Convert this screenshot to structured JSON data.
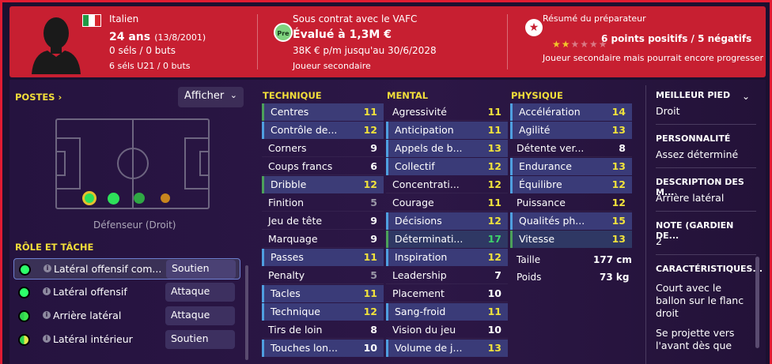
{
  "header": {
    "nationality": "Italien",
    "age_label": "24 ans",
    "birthdate": "(13/8/2001)",
    "caps": "0 séls / 0 buts",
    "u21_caps": "6 séls U21 / 0 buts",
    "contract_badge": "Pre",
    "contract_status": "Sous contrat avec le VAFC",
    "value": "Évalué à 1,3M €",
    "wage": "38K € p/m jusqu'au 30/6/2028",
    "squad_status": "Joueur secondaire",
    "coach_summary_title": "Résumé du préparateur",
    "coach_points": "6 points positifs / 5 négatifs",
    "coach_stars": 2,
    "coach_stars_max": 5,
    "coach_comment": "Joueur secondaire mais pourrait encore progresser"
  },
  "positions": {
    "title": "POSTES",
    "chevron": "›",
    "dropdown": "Afficher",
    "position_label": "Défenseur (Droit)"
  },
  "roles": {
    "title": "RÔLE ET TÂCHE",
    "items": [
      {
        "label": "Latéral offensif com...",
        "duty": "Soutien",
        "color": "#2dff6a"
      },
      {
        "label": "Latéral offensif",
        "duty": "Attaque",
        "color": "#2dff6a"
      },
      {
        "label": "Arrière latéral",
        "duty": "Attaque",
        "color": "#3ee64d"
      },
      {
        "label": "Latéral intérieur",
        "duty": "Soutien",
        "color": "#b4e83c"
      }
    ]
  },
  "technique": {
    "title": "TECHNIQUE",
    "items": [
      {
        "name": "Centres",
        "value": "11"
      },
      {
        "name": "Contrôle de...",
        "value": "12"
      },
      {
        "name": "Corners",
        "value": "9"
      },
      {
        "name": "Coups francs",
        "value": "6"
      },
      {
        "name": "Dribble",
        "value": "12"
      },
      {
        "name": "Finition",
        "value": "5"
      },
      {
        "name": "Jeu de tête",
        "value": "9"
      },
      {
        "name": "Marquage",
        "value": "9"
      },
      {
        "name": "Passes",
        "value": "11"
      },
      {
        "name": "Penalty",
        "value": "5"
      },
      {
        "name": "Tacles",
        "value": "11"
      },
      {
        "name": "Technique",
        "value": "12"
      },
      {
        "name": "Tirs de loin",
        "value": "8"
      },
      {
        "name": "Touches lon...",
        "value": "10"
      }
    ]
  },
  "mental": {
    "title": "MENTAL",
    "items": [
      {
        "name": "Agressivité",
        "value": "11"
      },
      {
        "name": "Anticipation",
        "value": "11"
      },
      {
        "name": "Appels de b...",
        "value": "13"
      },
      {
        "name": "Collectif",
        "value": "12"
      },
      {
        "name": "Concentrati...",
        "value": "12"
      },
      {
        "name": "Courage",
        "value": "11"
      },
      {
        "name": "Décisions",
        "value": "12"
      },
      {
        "name": "Déterminati...",
        "value": "17"
      },
      {
        "name": "Inspiration",
        "value": "12"
      },
      {
        "name": "Leadership",
        "value": "7"
      },
      {
        "name": "Placement",
        "value": "10"
      },
      {
        "name": "Sang-froid",
        "value": "11"
      },
      {
        "name": "Vision du jeu",
        "value": "10"
      },
      {
        "name": "Volume de j...",
        "value": "13"
      }
    ]
  },
  "physique": {
    "title": "PHYSIQUE",
    "items": [
      {
        "name": "Accélération",
        "value": "14"
      },
      {
        "name": "Agilité",
        "value": "13"
      },
      {
        "name": "Détente ver...",
        "value": "8"
      },
      {
        "name": "Endurance",
        "value": "13"
      },
      {
        "name": "Équilibre",
        "value": "12"
      },
      {
        "name": "Puissance",
        "value": "12"
      },
      {
        "name": "Qualités ph...",
        "value": "15"
      },
      {
        "name": "Vitesse",
        "value": "13"
      }
    ],
    "height_label": "Taille",
    "height_value": "177 cm",
    "weight_label": "Poids",
    "weight_value": "73 kg"
  },
  "sidebar": {
    "best_foot_title": "MEILLEUR PIED",
    "best_foot_value": "Droit",
    "personality_title": "PERSONNALITÉ",
    "personality_value": "Assez déterminé",
    "description_title": "DESCRIPTION DES M...",
    "description_value": "Arrière latéral",
    "gk_rating_title": "NOTE (GARDIEN DE...",
    "gk_rating_value": "2",
    "traits_title": "CARACTÉRISTIQUES...",
    "trait1_line1": "Court avec le",
    "trait1_line2": "ballon sur le flanc",
    "trait1_line3": "droit",
    "trait2_line1": "Se projette vers",
    "trait2_line2": "l'avant dès que"
  },
  "colors": {
    "header_red": "#c71f31",
    "highlight_yellow": "#f2de3a",
    "good_green": "#3ed26a"
  }
}
